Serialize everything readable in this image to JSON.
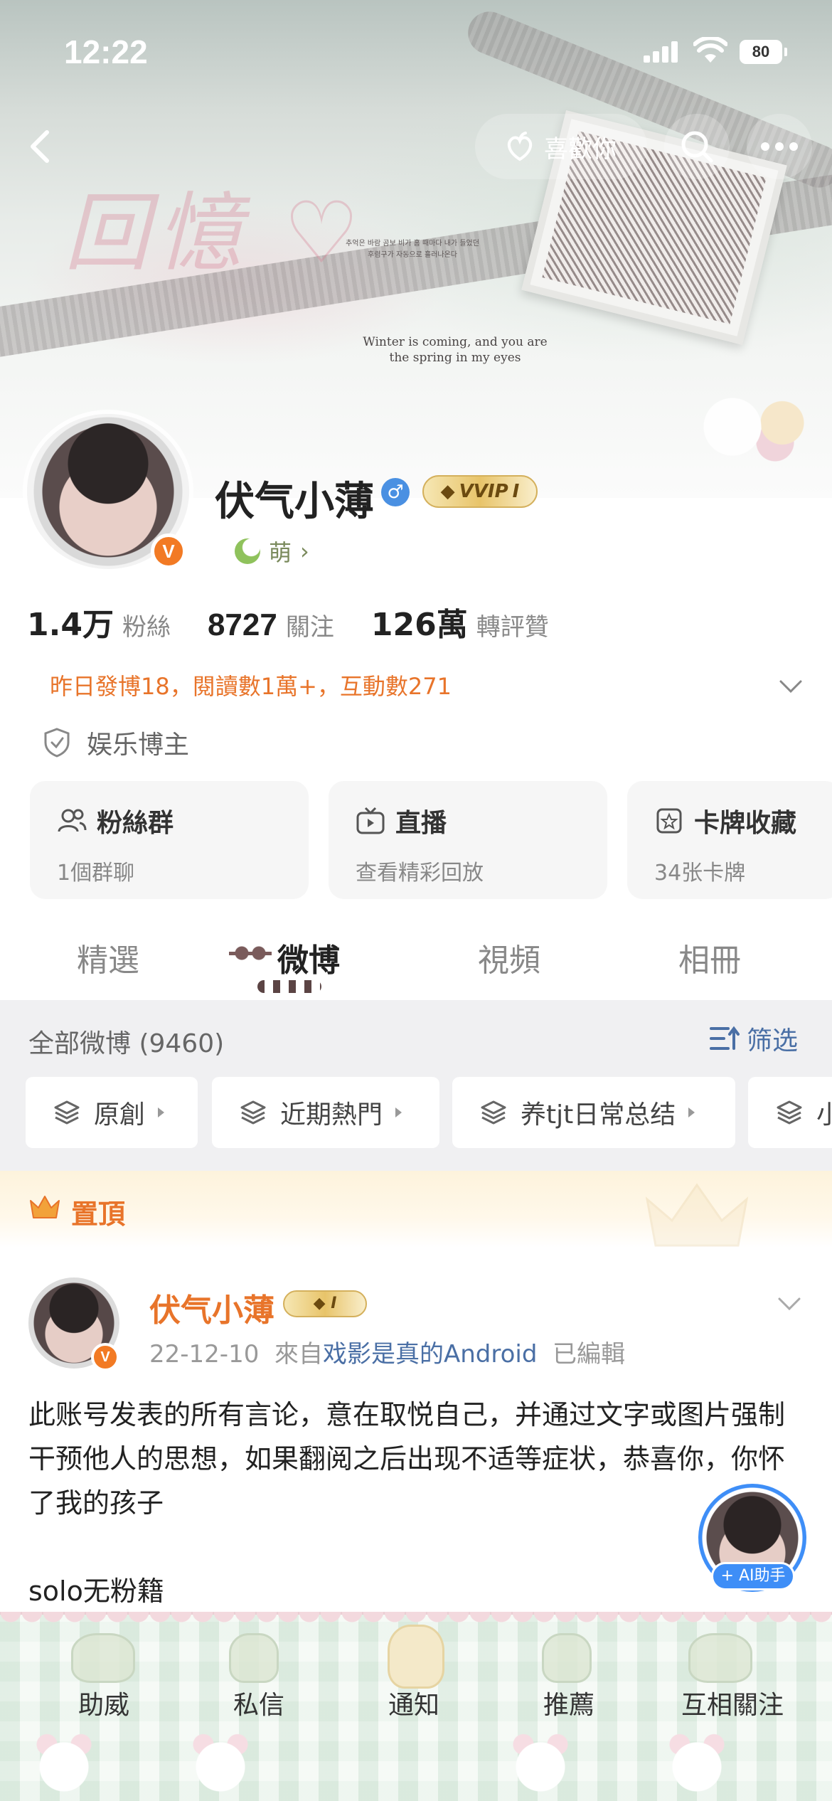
{
  "status_bar": {
    "time": "12:22",
    "battery": "80"
  },
  "header": {
    "like_label": "喜歡你",
    "banner_caption_line1": "Winter is coming, and you are",
    "banner_caption_line2": "the spring in my eyes",
    "banner_small_line1": "추억은 바람 곰보 비가 홈 때마다 내가 들었던",
    "banner_small_line2": "후렴구가 자동으로 흘러나온다"
  },
  "profile": {
    "name": "伏气小薄",
    "verified_badge": "V",
    "vip_label": "VVIP",
    "vip_level": "I",
    "mood_label": "萌",
    "stats": [
      {
        "number": "1.4万",
        "label": "粉絲"
      },
      {
        "number": "8727",
        "label": "關注"
      },
      {
        "number": "126萬",
        "label": "轉評贊"
      }
    ],
    "activity": "昨日發博18，閱讀數1萬+，互動數271",
    "tag": "娱乐博主"
  },
  "cards": [
    {
      "title": "粉絲群",
      "subtitle": "1個群聊",
      "icon": "group-icon"
    },
    {
      "title": "直播",
      "subtitle": "查看精彩回放",
      "icon": "tv-icon"
    },
    {
      "title": "卡牌收藏",
      "subtitle": "34张卡牌",
      "icon": "card-star-icon"
    }
  ],
  "tabs": [
    {
      "label": "精選"
    },
    {
      "label": "微博"
    },
    {
      "label": "視頻"
    },
    {
      "label": "相冊"
    }
  ],
  "feed": {
    "count_label": "全部微博 (9460)",
    "filter_label": "筛选",
    "chips": [
      {
        "label": "原創"
      },
      {
        "label": "近期熱門"
      },
      {
        "label": "养tjt日常总结"
      },
      {
        "label": "小"
      }
    ]
  },
  "pinned": {
    "label": "置頂"
  },
  "post": {
    "author": "伏气小薄",
    "badge_level": "I",
    "date": "22-12-10",
    "from_prefix": "來自",
    "source": "戏影是真的Android",
    "edited": "已編輯",
    "body": "此账号发表的所有言论，意在取悦自己，并通过文字或图片强制干预他人的思想，如果翻阅之后出现不适等症状，恭喜你，你怀了我的孩子",
    "body2": "solo无粉籍"
  },
  "ai_helper": {
    "label": "+ AI助手"
  },
  "bottom_nav": [
    {
      "label": "助威"
    },
    {
      "label": "私信"
    },
    {
      "label": "通知"
    },
    {
      "label": "推薦"
    },
    {
      "label": "互相關注"
    }
  ],
  "colors": {
    "accent_orange": "#e8742a",
    "link_blue": "#4a6fa5",
    "verified_orange": "#f27a24"
  }
}
